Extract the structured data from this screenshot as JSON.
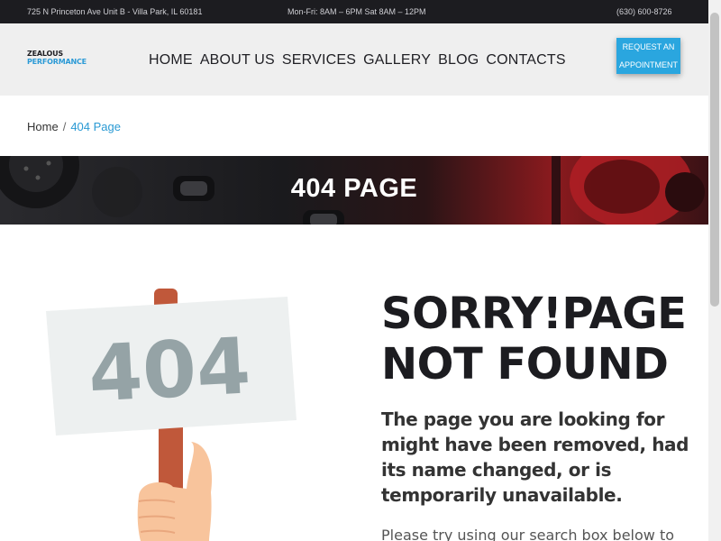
{
  "topbar": {
    "address": "725 N Princeton Ave Unit B - Villa Park, IL 60181",
    "hours": "Mon-Fri: 8AM – 6PM Sat 8AM – 12PM",
    "phone": "(630) 600-8726"
  },
  "logo": {
    "line1": "ZEALOUS",
    "line2": "PERFORMANCE"
  },
  "nav": {
    "items": [
      "HOME",
      "ABOUT US",
      "SERVICES",
      "GALLERY",
      "BLOG",
      "CONTACTS"
    ]
  },
  "cta": {
    "line1": "REQUEST AN",
    "line2": "APPOINTMENT"
  },
  "breadcrumb": {
    "home": "Home",
    "separator": "/",
    "current": "404 Page"
  },
  "hero": {
    "title": "404 PAGE"
  },
  "illustration": {
    "sign_text": "404"
  },
  "error": {
    "title_line1": "SORRY!PAGE",
    "title_line2": "NOT FOUND",
    "lead": "The page you are looking for might have been removed, had its name changed, or is temporarily unavailable.",
    "hint": "Please try using our search box below to"
  },
  "colors": {
    "accent": "#2aa6df",
    "dark": "#1c1c20",
    "sign_digits": "#95a3a6"
  }
}
